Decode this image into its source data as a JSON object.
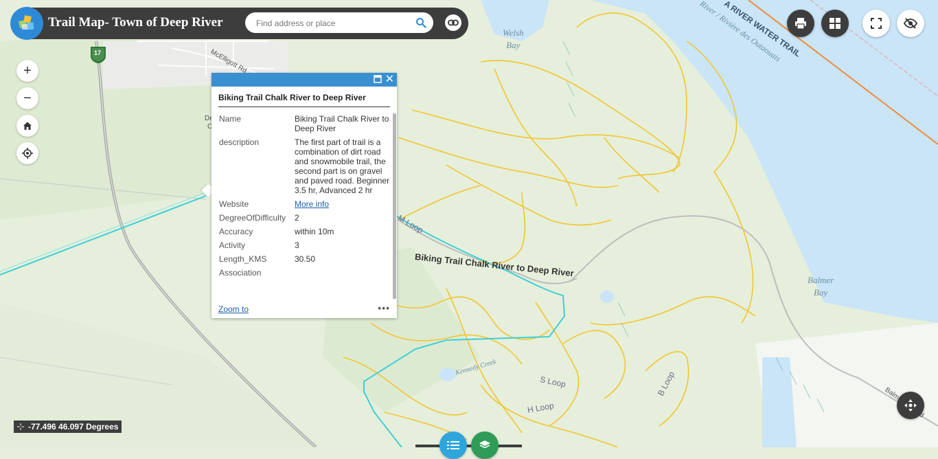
{
  "header": {
    "title": "Trail Map- Town of Deep River",
    "search_placeholder": "Find address or place",
    "search_icon": "search-icon",
    "link_icon": "link-icon",
    "logo_icon": "cube-logo-icon"
  },
  "toolbar": {
    "print_icon": "print-icon",
    "grid_icon": "grid-icon",
    "fullscreen_icon": "fullscreen-icon",
    "hide_icon": "eye-off-icon"
  },
  "map_controls": {
    "zoom_in": "+",
    "zoom_out": "−",
    "home_icon": "home-icon",
    "locate_icon": "locate-icon"
  },
  "map_labels": {
    "welsh_bay": [
      "Welsh",
      "Bay"
    ],
    "balmer_bay": [
      "Balmer",
      "Bay"
    ],
    "river": "River / Rivière des Outaouais",
    "water_trail": "A RIVER WATER TRAIL",
    "trail_name": "Biking Trail Chalk River to Deep River",
    "m_loop": "M Loop",
    "s_loop": "S Loop",
    "h_loop": "H Loop",
    "b_loop": "B Loop",
    "kennedy_creek": "Kennedy Creek",
    "mcelligott": "McElligott Rd",
    "balmer_rd": "Balmer Bay Rd",
    "highway": "17",
    "partial_label_1": "De",
    "partial_label_2": "C"
  },
  "popup": {
    "title": "Biking Trail Chalk River to Deep River",
    "fields": [
      {
        "field": "Name",
        "value": "Biking Trail Chalk River to Deep River"
      },
      {
        "field": "description",
        "value": "The first part of trail is a combination of dirt road and snowmobile trail, the second part is on gravel and paved road. Beginner 3.5 hr, Advanced 2 hr"
      },
      {
        "field": "Website",
        "value": "More info"
      },
      {
        "field": "DegreeOfDifficulty",
        "value": "2"
      },
      {
        "field": "Accuracy",
        "value": "within 10m"
      },
      {
        "field": "Activity",
        "value": "3"
      },
      {
        "field": "Length_KMS",
        "value": "30.50"
      },
      {
        "field": "Association",
        "value": ""
      }
    ],
    "zoom_to": "Zoom to",
    "more": "•••",
    "close": "✕"
  },
  "coordinates": {
    "text": "-77.496 46.097 Degrees"
  },
  "colors": {
    "header_bg": "#3d3d3d",
    "accent": "#3a8fd0",
    "water": "#c9e5f7",
    "land": "#e6efdb",
    "trail_yellow": "#f2c530",
    "trail_cyan": "#3ecfd6",
    "layer_green": "#2e9b57"
  }
}
